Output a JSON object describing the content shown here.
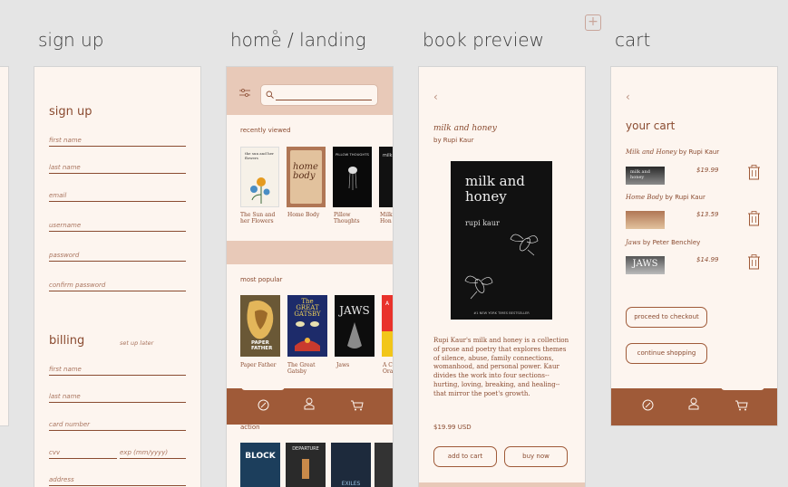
{
  "frames": {
    "signup_title": "sign up",
    "home_title": "home / landing",
    "preview_title": "book preview",
    "cart_title": "cart"
  },
  "signup": {
    "heading": "sign up",
    "fields": [
      "first name",
      "last name",
      "email",
      "username",
      "password",
      "confirm password"
    ],
    "billing_heading": "billing",
    "billing_note": "set up later",
    "billing_fields": [
      "first name",
      "last name",
      "card number"
    ],
    "cvv": "cvv",
    "exp": "exp (mm/yyyy)",
    "address": "address"
  },
  "home": {
    "search_placeholder": "",
    "recently_viewed_label": "recently viewed",
    "recently_viewed": [
      {
        "caption": "The Sun and her Flowers",
        "cover_title": "the sun and her flowers"
      },
      {
        "caption": "Home Body",
        "cover_title": "home body"
      },
      {
        "caption": "Pillow Thoughts",
        "cover_title": "PILLOW THOUGHTS"
      },
      {
        "caption": "Milk Hon",
        "cover_title": "milk"
      }
    ],
    "most_popular_label": "most popular",
    "most_popular": [
      {
        "caption": "Paper Father",
        "cover_title": "PAPER FATHER"
      },
      {
        "caption": "The Great Gatsby",
        "cover_title": "The GREAT GATSBY"
      },
      {
        "caption": "Jaws",
        "cover_title": "JAWS"
      },
      {
        "caption": "A C Ora",
        "cover_title": "A"
      }
    ],
    "action_label": "action",
    "action_books": [
      "BLOCK",
      "DEPARTURE",
      "EXILES",
      ""
    ]
  },
  "preview": {
    "title": "milk and honey",
    "author": "by Rupi Kaur",
    "cover_title": "milk and honey",
    "cover_author": "rupi kaur",
    "cover_banner": "#1 NEW YORK TIMES BESTSELLER",
    "description": "Rupi Kaur's milk and honey is a collection of prose and poetry that explores themes of silence, abuse, family connections, womanhood, and personal power. Kaur divides the work into four sections--hurting, loving, breaking, and healing--that mirror the poet's growth.",
    "price": "$19.99 USD",
    "add_to_cart": "add to cart",
    "buy_now": "buy now"
  },
  "cart": {
    "heading": "your cart",
    "items": [
      {
        "title": "Milk and Honey",
        "by": "by",
        "author": "Rupi Kaur",
        "price": "$19.99",
        "thumb_text": "milk and honey"
      },
      {
        "title": "Home Body",
        "by": "by",
        "author": "Rupi Kaur",
        "price": "$13.59",
        "thumb_text": ""
      },
      {
        "title": "Jaws",
        "by": "by",
        "author": "Peter Benchley",
        "price": "$14.99",
        "thumb_text": "JAWS"
      }
    ],
    "checkout": "proceed to checkout",
    "continue": "continue shopping"
  },
  "colors": {
    "accent": "#9f5a38",
    "panel": "#e8c9b8",
    "background": "#fdf5ef",
    "canvas": "#e5e5e5"
  },
  "icons": [
    "filter-icon",
    "search-icon",
    "compass-icon",
    "user-icon",
    "cart-icon",
    "trash-icon",
    "back-chevron-icon",
    "add-frame-icon"
  ]
}
